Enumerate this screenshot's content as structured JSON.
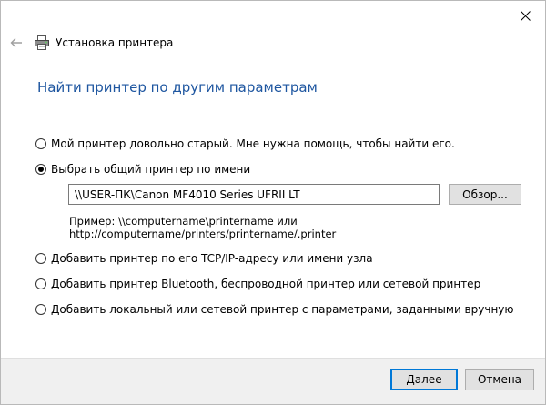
{
  "window": {
    "title": "Установка принтера"
  },
  "heading": "Найти принтер по другим параметрам",
  "options": [
    {
      "label": "Мой принтер довольно старый. Мне нужна помощь, чтобы найти его.",
      "checked": false
    },
    {
      "label": "Выбрать общий принтер по имени",
      "checked": true
    },
    {
      "label": "Добавить принтер по его TCP/IP-адресу или имени узла",
      "checked": false
    },
    {
      "label": "Добавить принтер Bluetooth, беспроводной принтер или сетевой принтер",
      "checked": false
    },
    {
      "label": "Добавить локальный или сетевой принтер с параметрами, заданными вручную",
      "checked": false
    }
  ],
  "share_name": {
    "value": "\\\\USER-ПК\\Canon MF4010 Series UFRII LT",
    "browse_label": "Обзор...",
    "example_line1": "Пример: \\\\computername\\printername или",
    "example_line2": "http://computername/printers/printername/.printer"
  },
  "footer": {
    "next_label": "Далее",
    "cancel_label": "Отмена"
  },
  "colors": {
    "heading": "#1e56a0",
    "accent": "#0078d7",
    "footer_bg": "#f0f0f0"
  }
}
